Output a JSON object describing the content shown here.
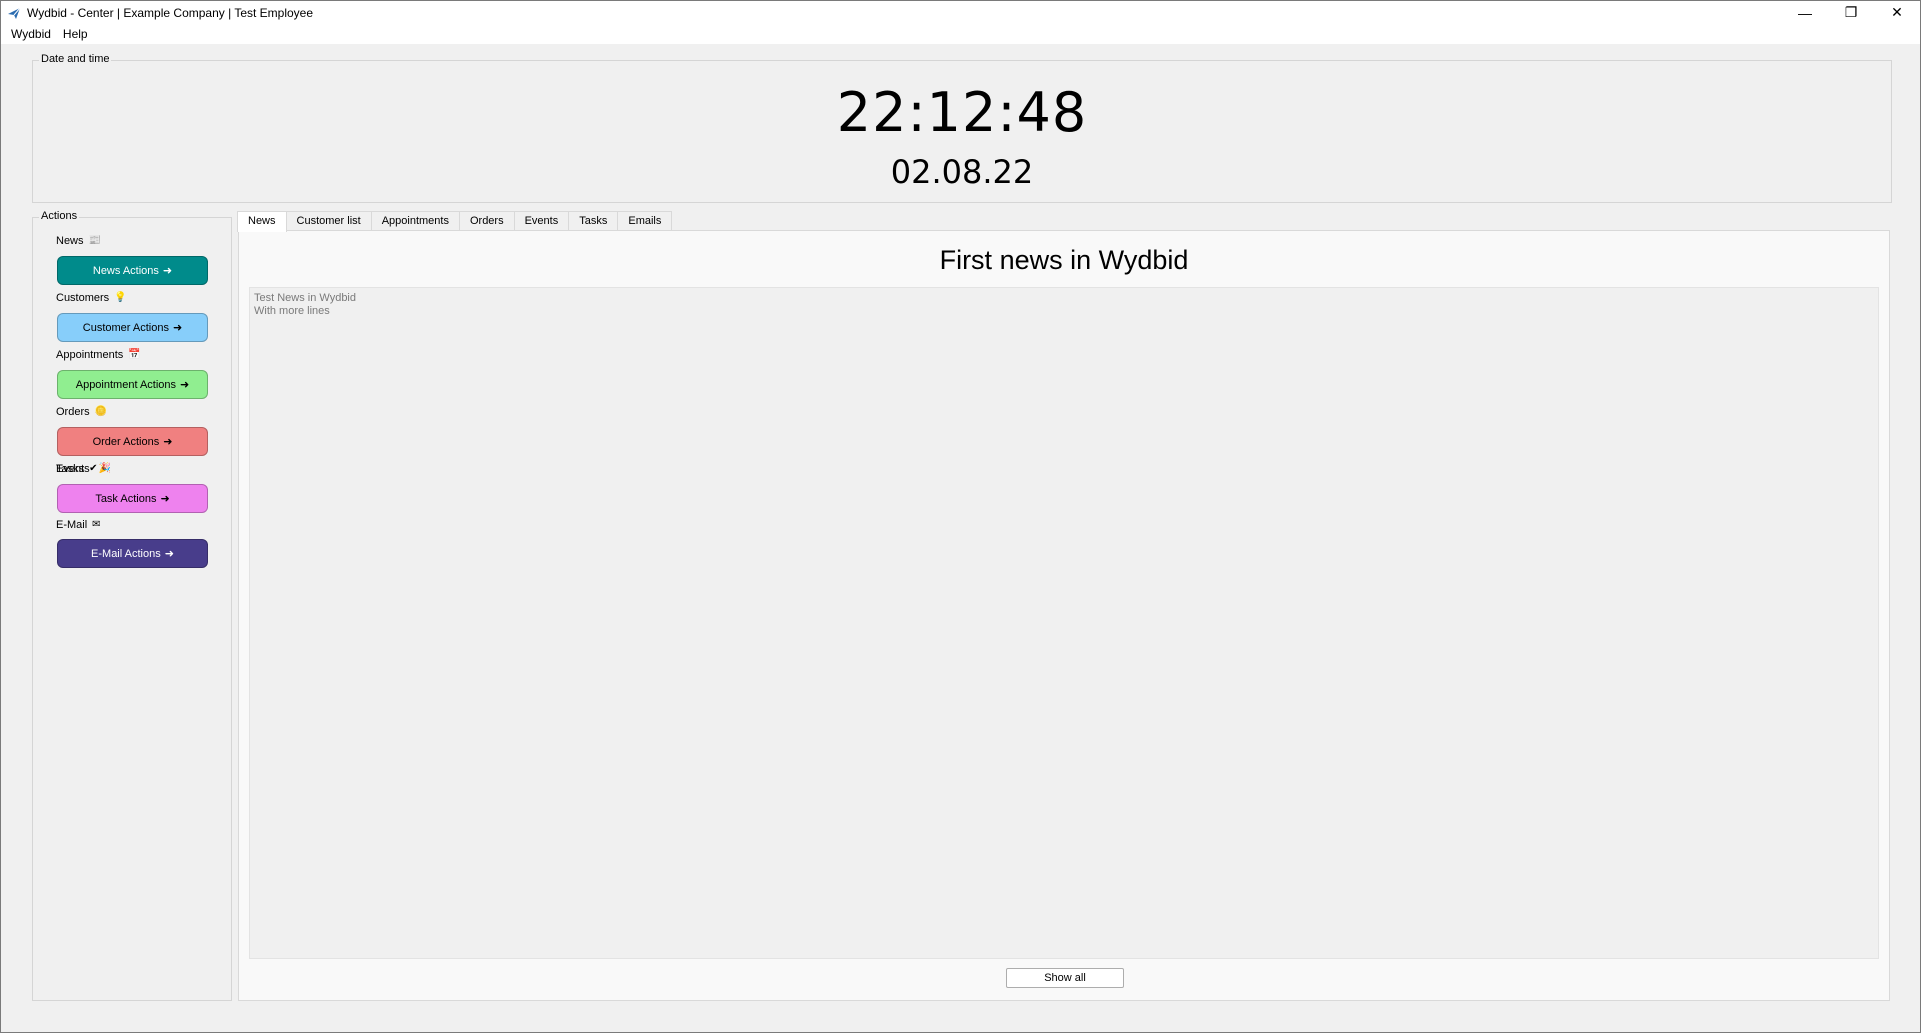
{
  "window": {
    "title": "Wydbid - Center | Example Company | Test Employee",
    "app_icon": "airplane-icon",
    "controls": {
      "minimize": "—",
      "restore": "❐",
      "close": "✕"
    }
  },
  "menubar": {
    "items": [
      "Wydbid",
      "Help"
    ]
  },
  "datetime": {
    "group_title": "Date and time",
    "time": "22:12:48",
    "date": "02.08.22"
  },
  "actions": {
    "group_title": "Actions",
    "sections": [
      {
        "label": "News",
        "icon": "📰",
        "icon_name": "newspaper-icon",
        "button": "News Actions",
        "color": "#008b8b"
      },
      {
        "label": "Customers",
        "icon": "💡",
        "icon_name": "lightbulb-icon",
        "button": "Customer Actions",
        "color": "#87cefa"
      },
      {
        "label": "Appointments",
        "icon": "📅",
        "icon_name": "calendar-icon",
        "button": "Appointment Actions",
        "color": "#90ee90"
      },
      {
        "label": "Orders",
        "icon": "🪙",
        "icon_name": "coin-icon",
        "button": "Order Actions",
        "color": "#f08080"
      },
      {
        "label": "Tasks",
        "icon": "✔",
        "icon_name": "checkmark-icon",
        "overlap_label": "Events",
        "overlap_icon": "🎉",
        "button": "Task Actions",
        "color": "#ee82ee"
      },
      {
        "label": "E-Mail",
        "icon": "✉",
        "icon_name": "envelope-icon",
        "button": "E-Mail Actions",
        "color": "#483d8b"
      }
    ],
    "arrow": "➜"
  },
  "tabs": {
    "items": [
      "News",
      "Customer list",
      "Appointments",
      "Orders",
      "Events",
      "Tasks",
      "Emails"
    ],
    "active": "News"
  },
  "news": {
    "title": "First news in Wydbid",
    "body_line1": "Test News in Wydbid",
    "body_line2": "With more lines",
    "show_all": "Show all"
  }
}
